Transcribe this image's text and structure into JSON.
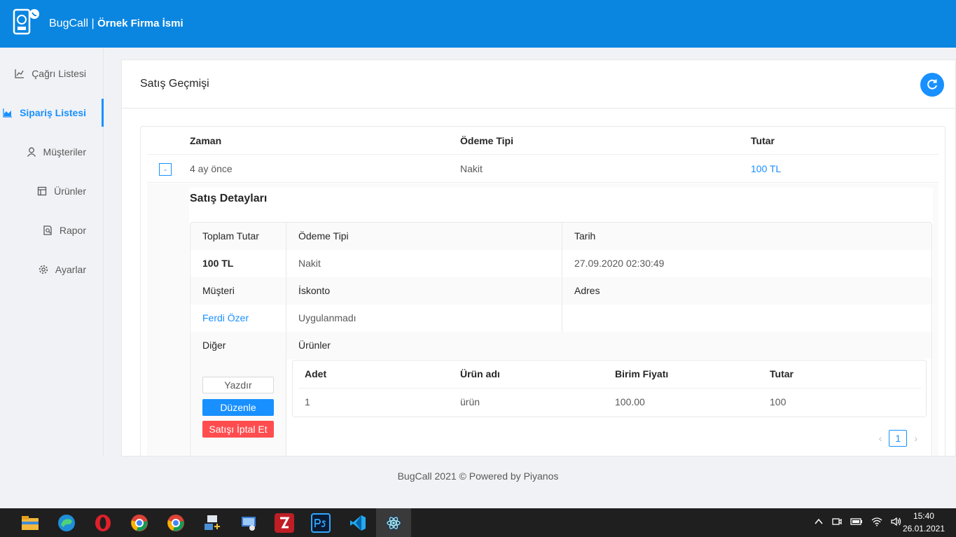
{
  "header": {
    "app_name": "BugCall",
    "separator": "|",
    "company": "Örnek Firma İsmi"
  },
  "sidebar": {
    "items": [
      {
        "label": "Çağrı Listesi",
        "icon": "line-chart-icon"
      },
      {
        "label": "Sipariş Listesi",
        "icon": "area-chart-icon",
        "active": true
      },
      {
        "label": "Müşteriler",
        "icon": "user-icon"
      },
      {
        "label": "Ürünler",
        "icon": "product-icon"
      },
      {
        "label": "Rapor",
        "icon": "report-icon"
      },
      {
        "label": "Ayarlar",
        "icon": "settings-icon"
      }
    ]
  },
  "main": {
    "title": "Satış Geçmişi",
    "table": {
      "columns": [
        "Zaman",
        "Ödeme Tipi",
        "Tutar"
      ],
      "row": {
        "expand": "-",
        "time": "4 ay önce",
        "payment": "Nakit",
        "amount": "100 TL"
      }
    },
    "details": {
      "title": "Satış Detayları",
      "labels": {
        "total": "Toplam Tutar",
        "payment": "Ödeme Tipi",
        "date": "Tarih",
        "customer": "Müşteri",
        "discount": "İskonto",
        "address": "Adres",
        "other": "Diğer",
        "products": "Ürünler"
      },
      "values": {
        "total": "100 TL",
        "payment": "Nakit",
        "date": "27.09.2020 02:30:49",
        "customer": "Ferdi Özer",
        "discount": "Uygulanmadı"
      },
      "buttons": {
        "print": "Yazdır",
        "edit": "Düzenle",
        "cancel": "Satışı İptal Et"
      },
      "products_table": {
        "columns": [
          "Adet",
          "Ürün adı",
          "Birim Fiyatı",
          "Tutar"
        ],
        "rows": [
          {
            "qty": "1",
            "name": "ürün",
            "unit_price": "100.00",
            "total": "100"
          }
        ]
      },
      "pagination": {
        "prev": "‹",
        "page": "1",
        "next": "›"
      }
    }
  },
  "footer": {
    "text": "BugCall 2021 © Powered by Piyanos"
  },
  "taskbar": {
    "time": "15:40",
    "date": "26.01.2021",
    "apps": [
      "file-explorer-icon",
      "edge-icon",
      "opera-icon",
      "chrome-icon",
      "chrome-profile-icon",
      "network-app-icon",
      "remote-desktop-icon",
      "filezilla-icon",
      "photoshop-icon",
      "vscode-icon",
      "electron-icon"
    ]
  },
  "colors": {
    "primary": "#1890ff",
    "header": "#0a86e0",
    "danger": "#ff4d4f"
  }
}
